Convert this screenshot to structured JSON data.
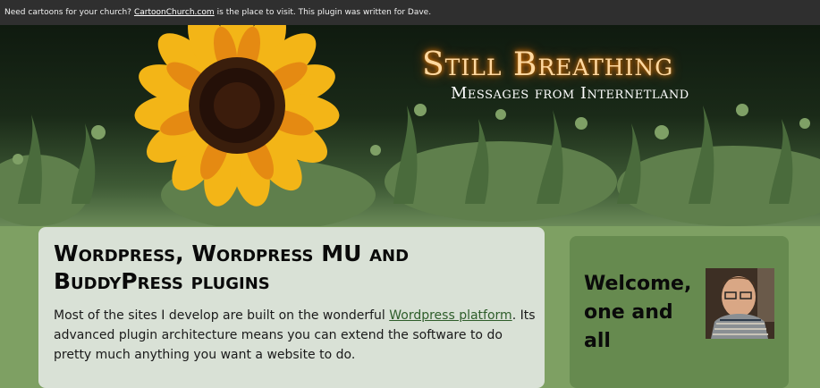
{
  "notice": {
    "prefix": "Need cartoons for your church?",
    "link": "CartoonChurch.com",
    "suffix": "is the place to visit. This plugin was written for Dave."
  },
  "header": {
    "site_title": "Still Breathing",
    "tagline": "Messages from Internetland"
  },
  "post": {
    "title": "Wordpress, Wordpress MU and BuddyPress plugins",
    "body_prefix": "Most of the sites I develop are built on the wonderful",
    "body_link": "Wordpress platform",
    "body_suffix": ". Its advanced plugin architecture means you can extend the software to do pretty much anything you want a website to do."
  },
  "sidebar": {
    "welcome": "Welcome, one and all"
  },
  "colors": {
    "page_bg": "#7ea063",
    "card_bg": "#d9e1d6",
    "sidebar_bg": "#668a4f",
    "notice_bg": "#2f2f2f"
  }
}
